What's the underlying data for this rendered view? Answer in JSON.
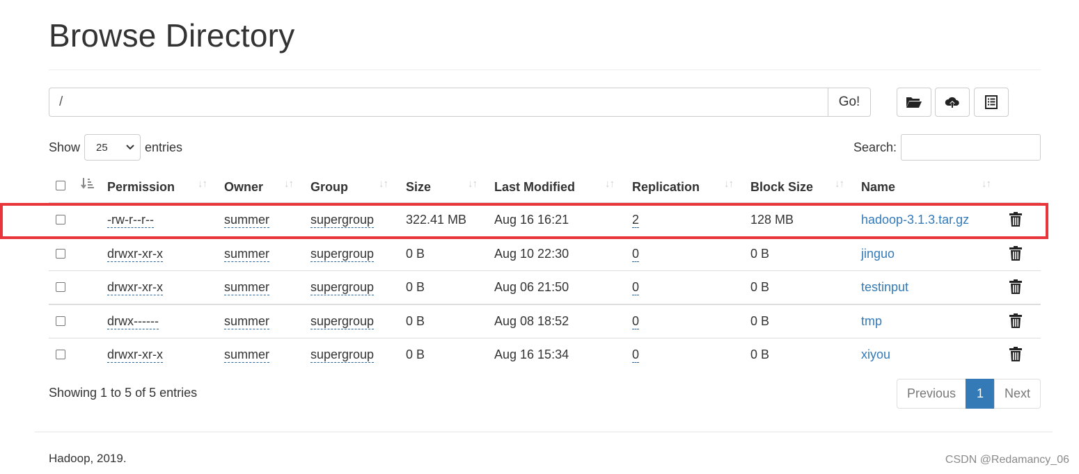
{
  "page": {
    "title": "Browse Directory"
  },
  "path_bar": {
    "value": "/",
    "go_label": "Go!"
  },
  "toolbar": {
    "icons": [
      "folder-open-icon",
      "cloud-upload-icon",
      "list-icon"
    ]
  },
  "length": {
    "show_label": "Show",
    "selected": "25",
    "entries_label": "entries"
  },
  "search": {
    "label": "Search:",
    "value": ""
  },
  "table": {
    "columns": [
      "Permission",
      "Owner",
      "Group",
      "Size",
      "Last Modified",
      "Replication",
      "Block Size",
      "Name"
    ],
    "rows": [
      {
        "permission": "-rw-r--r--",
        "owner": "summer",
        "group": "supergroup",
        "size": "322.41 MB",
        "modified": "Aug 16 16:21",
        "replication": "2",
        "block_size": "128 MB",
        "name": "hadoop-3.1.3.tar.gz"
      },
      {
        "permission": "drwxr-xr-x",
        "owner": "summer",
        "group": "supergroup",
        "size": "0 B",
        "modified": "Aug 10 22:30",
        "replication": "0",
        "block_size": "0 B",
        "name": "jinguo"
      },
      {
        "permission": "drwxr-xr-x",
        "owner": "summer",
        "group": "supergroup",
        "size": "0 B",
        "modified": "Aug 06 21:50",
        "replication": "0",
        "block_size": "0 B",
        "name": "testinput"
      },
      {
        "permission": "drwx------",
        "owner": "summer",
        "group": "supergroup",
        "size": "0 B",
        "modified": "Aug 08 18:52",
        "replication": "0",
        "block_size": "0 B",
        "name": "tmp"
      },
      {
        "permission": "drwxr-xr-x",
        "owner": "summer",
        "group": "supergroup",
        "size": "0 B",
        "modified": "Aug 16 15:34",
        "replication": "0",
        "block_size": "0 B",
        "name": "xiyou"
      }
    ]
  },
  "info": {
    "text": "Showing 1 to 5 of 5 entries"
  },
  "pagination": {
    "previous": "Previous",
    "current": "1",
    "next": "Next"
  },
  "footer": {
    "text": "Hadoop, 2019."
  },
  "watermark": {
    "text": "CSDN @Redamancy_06"
  },
  "colors": {
    "link": "#337ab7",
    "highlight": "#e8343b",
    "active_page": "#337ab7"
  }
}
